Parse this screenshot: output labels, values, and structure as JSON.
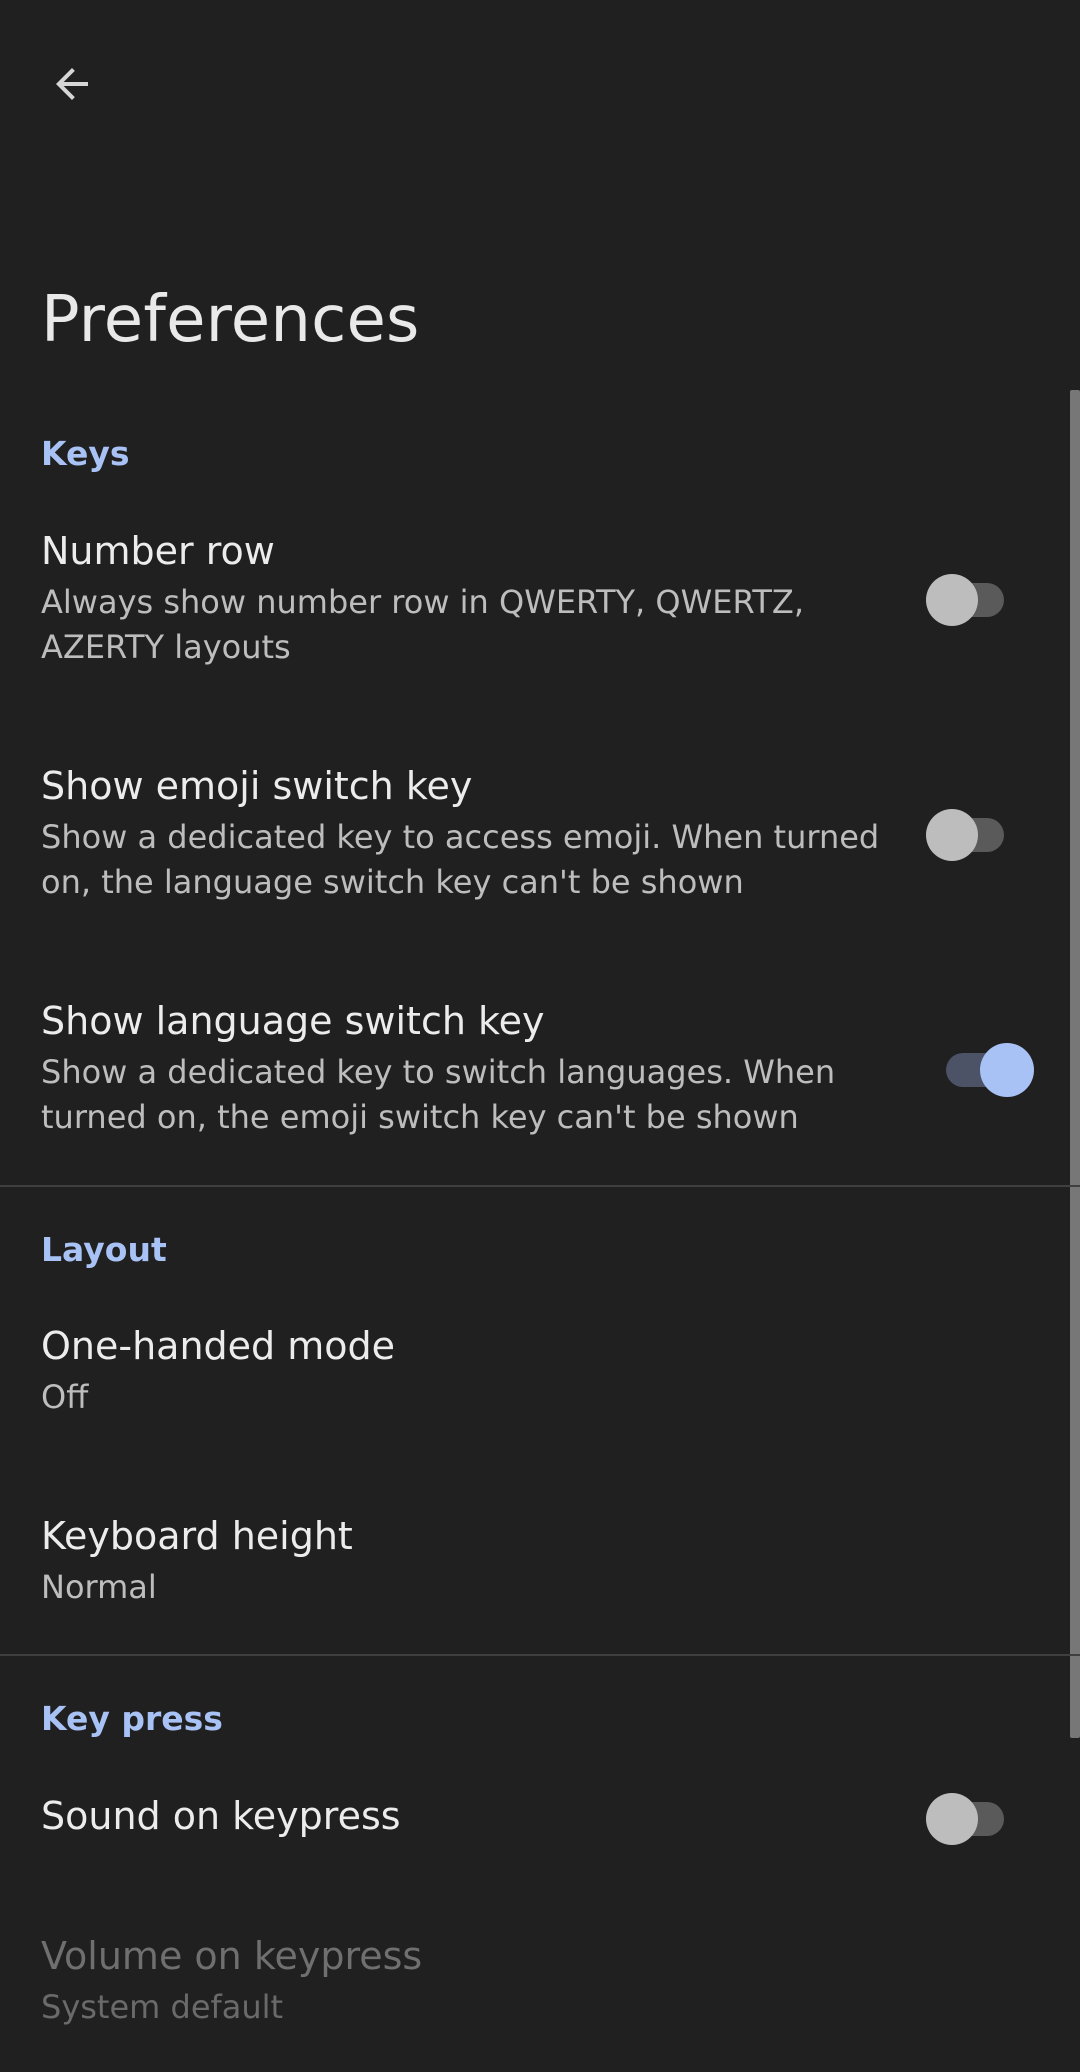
{
  "header": {
    "title": "Preferences",
    "back_icon": "arrow-back-icon"
  },
  "colors": {
    "background": "#202020",
    "accent": "#a8c2f5",
    "divider": "#3f3f3f"
  },
  "sections": {
    "keys": {
      "label": "Keys",
      "number_row": {
        "title": "Number row",
        "summary": "Always show number row in QWERTY, QWERTZ, AZERTY layouts",
        "enabled": false
      },
      "emoji_key": {
        "title": "Show emoji switch key",
        "summary": "Show a dedicated key to access emoji. When turned on, the language switch key can't be shown",
        "enabled": false
      },
      "language_key": {
        "title": "Show language switch key",
        "summary": "Show a dedicated key to switch languages. When turned on, the emoji switch key can't be shown",
        "enabled": true
      }
    },
    "layout": {
      "label": "Layout",
      "one_handed": {
        "title": "One-handed mode",
        "value": "Off"
      },
      "keyboard_height": {
        "title": "Keyboard height",
        "value": "Normal"
      }
    },
    "key_press": {
      "label": "Key press",
      "sound": {
        "title": "Sound on keypress",
        "enabled": false
      },
      "volume": {
        "title": "Volume on keypress",
        "value": "System default",
        "disabled": true
      }
    }
  }
}
